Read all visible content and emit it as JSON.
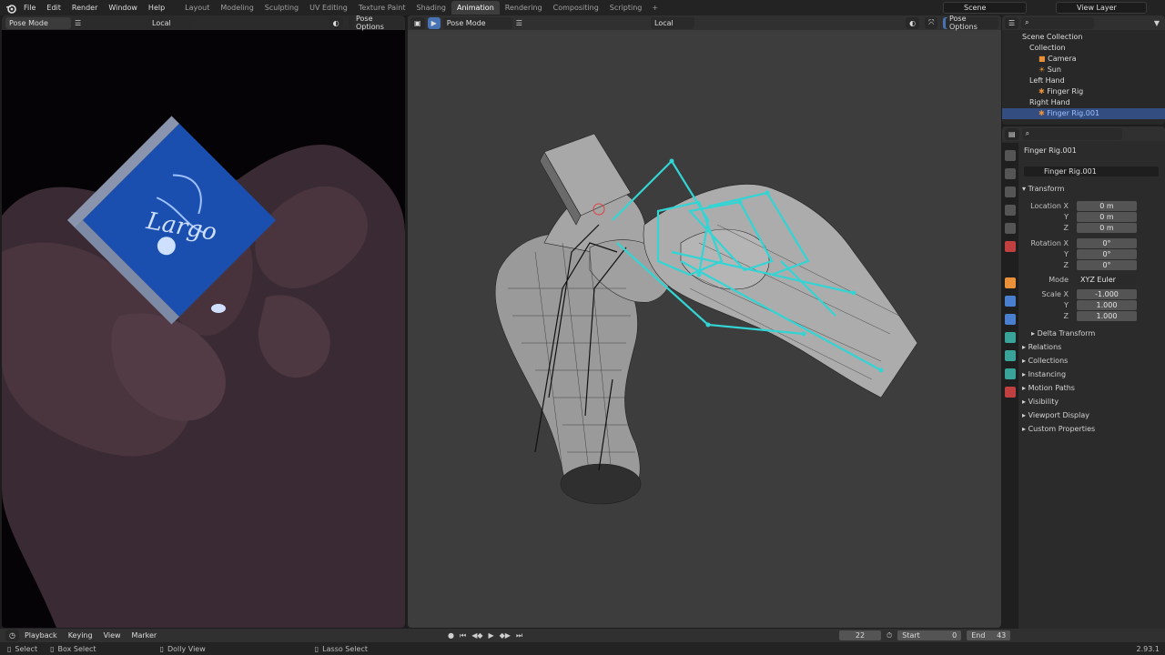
{
  "menu": [
    "File",
    "Edit",
    "Render",
    "Window",
    "Help"
  ],
  "workspaces": [
    "Layout",
    "Modeling",
    "Sculpting",
    "UV Editing",
    "Texture Paint",
    "Shading",
    "Animation",
    "Rendering",
    "Compositing",
    "Scripting"
  ],
  "active_workspace": "Animation",
  "scene": "Scene",
  "view_layer": "View Layer",
  "top_orientation": "Local",
  "top_pose_options": "Pose Options",
  "left_viewport": {
    "mode": "Pose Mode"
  },
  "mid_viewport": {
    "mode": "Pose Mode",
    "orientation": "Local",
    "pose_options": "Pose Options"
  },
  "outliner": {
    "rows": [
      {
        "label": "Scene Collection"
      },
      {
        "label": "Collection"
      },
      {
        "label": "Camera"
      },
      {
        "label": "Sun"
      },
      {
        "label": "Left Hand"
      },
      {
        "label": "Finger Rig"
      },
      {
        "label": "Right Hand"
      },
      {
        "label": "Finger Rig.001"
      }
    ]
  },
  "properties": {
    "object_name": "Finger Rig.001",
    "object_field": "Finger Rig.001",
    "transform_title": "Transform",
    "location_label": "Location X",
    "rotation_label": "Rotation X",
    "scale_label": "Scale X",
    "y": "Y",
    "z": "Z",
    "location": [
      "0 m",
      "0 m",
      "0 m"
    ],
    "rotation": [
      "0°",
      "0°",
      "0°"
    ],
    "mode_label": "Mode",
    "mode_value": "XYZ Euler",
    "scale": [
      "-1.000",
      "1.000",
      "1.000"
    ],
    "delta_transform": "Delta Transform",
    "sections": [
      "Relations",
      "Collections",
      "Instancing",
      "Motion Paths",
      "Visibility",
      "Viewport Display",
      "Custom Properties"
    ]
  },
  "timeline": {
    "menus": [
      "Playback",
      "Keying",
      "View",
      "Marker"
    ],
    "current_frame": "22",
    "start_label": "Start",
    "start_value": "0",
    "end_label": "End",
    "end_value": "43"
  },
  "status": {
    "select": "Select",
    "box_select": "Box Select",
    "dolly_view": "Dolly View",
    "lasso_select": "Lasso Select",
    "version": "2.93.1"
  },
  "artwork": {
    "box_text": "Largo"
  },
  "colors": {
    "accent": "#4772b3",
    "bone_selected": "#33d4d4",
    "box_blue": "#1a4fb0"
  }
}
